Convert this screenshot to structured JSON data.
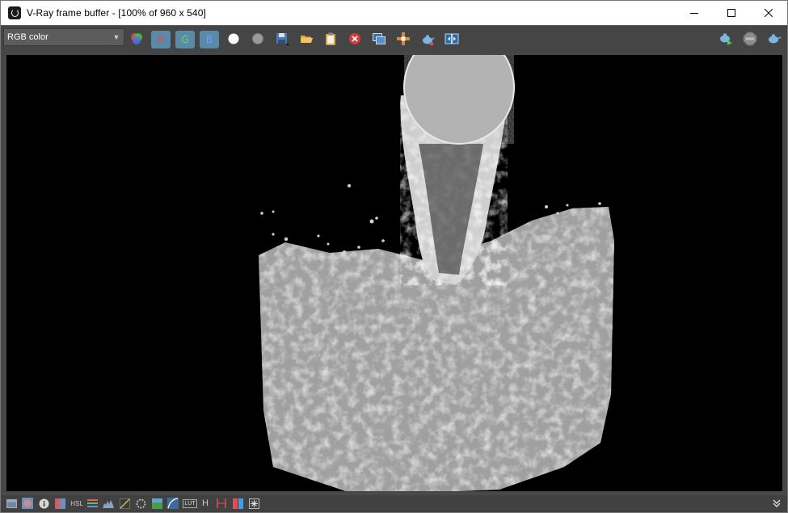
{
  "window": {
    "title": "V-Ray frame buffer - [100% of 960 x 540]"
  },
  "toolbar": {
    "channel_select": {
      "value": "RGB color"
    },
    "channel_buttons": {
      "r": "R",
      "g": "G",
      "b": "B"
    },
    "icons": [
      "color-channels-icon",
      "r-channel-button",
      "g-channel-button",
      "b-channel-button",
      "white-dot-icon",
      "grey-dot-icon",
      "save-icon",
      "open-folder-icon",
      "clipboard-icon",
      "clear-icon",
      "duplicate-icon",
      "track-mouse-icon",
      "render-teapot-icon",
      "compare-icon",
      "render-start-icon",
      "stop-icon",
      "render-region-icon"
    ]
  },
  "render": {
    "description_colors": {
      "background": "#000000",
      "water": "#e8e8e8"
    }
  },
  "statusbar": {
    "icons": [
      "panel-icon",
      "globe-icon",
      "info-icon",
      "gradient-icon",
      "hsl-icon",
      "levels-icon",
      "histogram-icon",
      "curves-icon",
      "settings-icon",
      "image-icon",
      "curve-icon",
      "lut-icon",
      "h-icon",
      "markers-icon",
      "split-icon",
      "sparkle-icon",
      "expand-icon"
    ],
    "labels": {
      "hsl": "HSL",
      "lut": "LUT",
      "h": "H"
    }
  }
}
